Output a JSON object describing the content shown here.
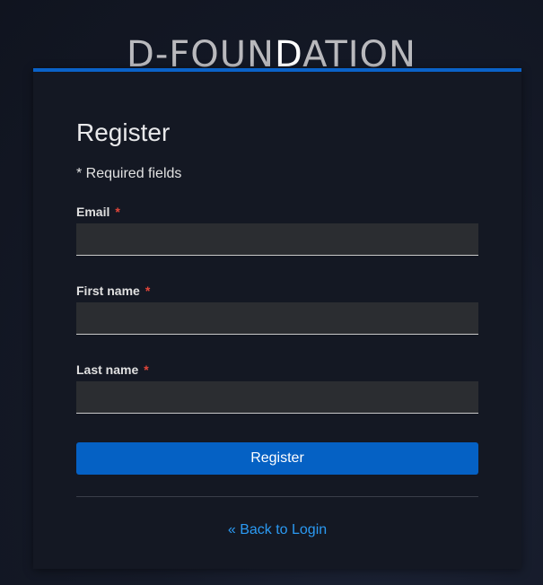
{
  "brand": {
    "logo_part1": "D-FOUN",
    "logo_part2": "D",
    "logo_part3": "ATION",
    "accent_color": "#0a62c8"
  },
  "form": {
    "title": "Register",
    "required_note": "* Required fields",
    "required_marker": "*",
    "fields": [
      {
        "label": "Email",
        "value": ""
      },
      {
        "label": "First name",
        "value": ""
      },
      {
        "label": "Last name",
        "value": ""
      }
    ],
    "submit_label": "Register",
    "back_link": "« Back to Login",
    "link_color": "#2b9af3",
    "button_color": "#0561c4"
  }
}
